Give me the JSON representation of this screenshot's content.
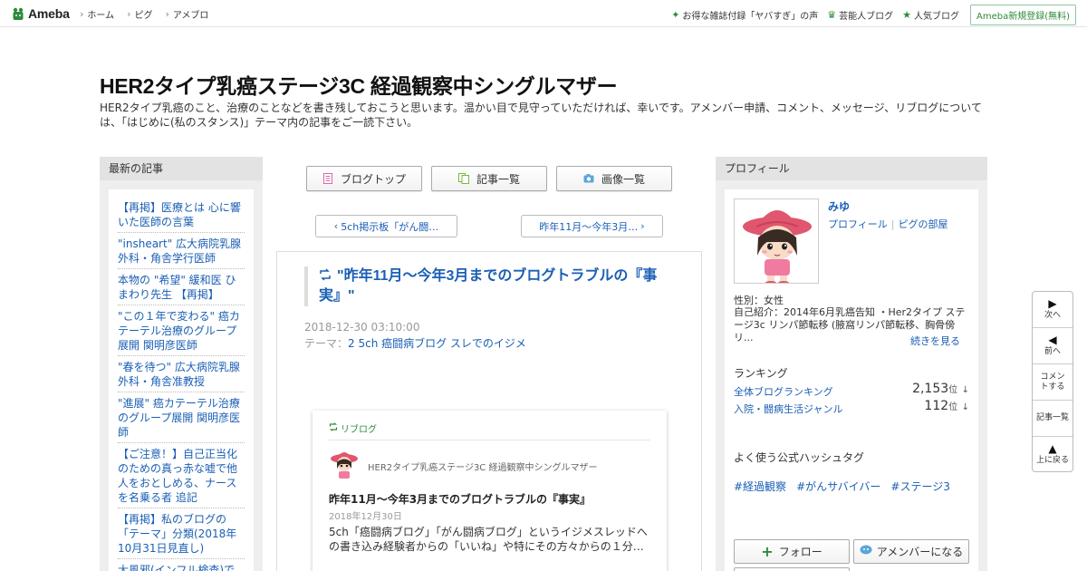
{
  "topbar": {
    "logo_text": "Ameba",
    "nav": [
      "ホーム",
      "ピグ",
      "アメブロ"
    ],
    "right_items": [
      {
        "icon": "sparkle-icon",
        "glyph": "✦",
        "label": "お得な雑誌付録「ヤバすぎ」の声"
      },
      {
        "icon": "crown-icon",
        "glyph": "♛",
        "label": "芸能人ブログ"
      },
      {
        "icon": "star-icon",
        "glyph": "★",
        "label": "人気ブログ"
      }
    ],
    "signup_label": "Ameba新規登録(無料)"
  },
  "header": {
    "title": "HER2タイプ乳癌ステージ3C 経過観察中シングルマザー",
    "description": "HER2タイプ乳癌のこと、治療のことなどを書き残しておこうと思います。温かい目で見守っていただければ、幸いです。アメンバー申請、コメント、メッセージ、リブログについては、「はじめに(私のスタンス)」テーマ内の記事をご一読下さい。"
  },
  "left": {
    "heading": "最新の記事",
    "articles": [
      "【再掲】医療とは 心に響いた医師の言葉",
      "\"insheart\" 広大病院乳腺外科・角舎学行医師",
      "本物の \"希望\" 緩和医 ひまわり先生 【再掲】",
      "\"この１年で変わる\" 癌カテーテル治療のグループ展開 関明彦医師",
      "\"春を待つ\" 広大病院乳腺外科・角舎准教授",
      "\"進展\" 癌カテーテル治療のグループ展開 関明彦医師",
      "【ご注意！】自己正当化のための真っ赤な嘘で他人をおとしめる、ナースを名乗る者 追記",
      "【再掲】私のブログの「テーマ」分類(2018年10月31日見直し)",
      "大風邪(インフル検査)で休"
    ]
  },
  "center": {
    "tabs": [
      {
        "label": "ブログトップ",
        "icon": "document-icon"
      },
      {
        "label": "記事一覧",
        "icon": "copy-icon"
      },
      {
        "label": "画像一覧",
        "icon": "camera-icon"
      }
    ],
    "prev_label": "5ch掲示板「がん闘…",
    "next_label": "昨年11月～今年3月…",
    "entry": {
      "title": "\"昨年11月～今年3月までのブログトラブルの『事実』\"",
      "date": "2018-12-30 03:10:00",
      "theme_prefix": "テーマ：",
      "theme": "2 5ch 癌闘病ブログ スレでのイジメ"
    },
    "reblog": {
      "label": "リブログ",
      "blog_name": "HER2タイプ乳癌ステージ3C 経過観察中シングルマザー",
      "title": "昨年11月～今年3月までのブログトラブルの『事実』",
      "date": "2018年12月30日",
      "excerpt": "5ch「癌闘病ブログ」「がん闘病ブログ」というイジメスレッドへの書き込み経験者からの「いいね」や特にその方々からの１分…"
    }
  },
  "profile": {
    "heading": "プロフィール",
    "name": "みゆ",
    "link_profile": "プロフィール",
    "link_separator": "|",
    "link_pig": "ピグの部屋",
    "gender": "性別：女性",
    "intro": "自己紹介：2014年6月乳癌告知 ・Her2タイプ ステージ3c リンパ節転移 (腋窩リンパ節転移、胸骨傍リ...",
    "more": "続きを見る",
    "ranking_heading": "ランキング",
    "rankings": [
      {
        "label": "全体ブログランキング",
        "value": "2,153",
        "unit": "位",
        "trend": "↓"
      },
      {
        "label": "入院・闘病生活ジャンル",
        "value": "112",
        "unit": "位",
        "trend": "↓"
      }
    ],
    "hashtag_heading": "よく使う公式ハッシュタグ",
    "hashtags": [
      "#経過観察",
      "#がんサバイバー",
      "#ステージ3"
    ],
    "follow_label": "フォロー",
    "member_label": "アメンバーになる"
  },
  "floatnav": [
    {
      "arrow": "▶",
      "label": "次へ",
      "icon": "next-arrow-icon"
    },
    {
      "arrow": "◀",
      "label": "前へ",
      "icon": "prev-arrow-icon"
    },
    {
      "arrow": "",
      "label": "コメントする",
      "icon": ""
    },
    {
      "arrow": "",
      "label": "記事一覧",
      "icon": ""
    },
    {
      "arrow": "▲",
      "label": "上に戻る",
      "icon": "up-arrow-icon"
    }
  ],
  "colors": {
    "link": "#1a5fb4",
    "brand_green": "#2e8b3a",
    "panel_gray": "#eeeeee"
  }
}
